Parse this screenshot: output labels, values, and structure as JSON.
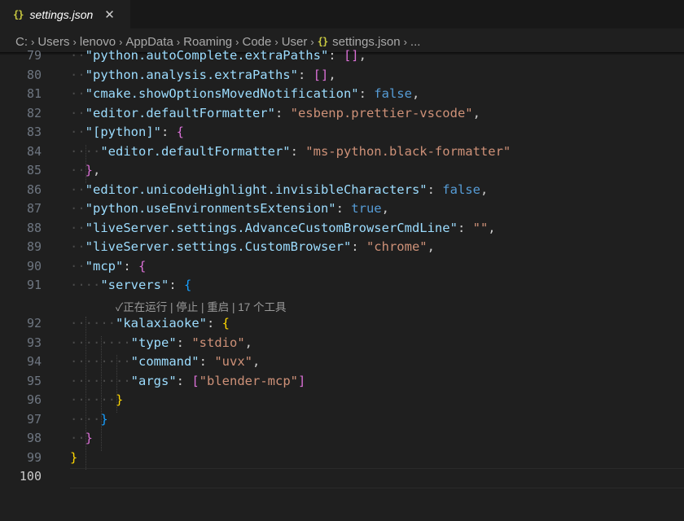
{
  "tab": {
    "icon": "{}",
    "title": "settings.json",
    "close": "✕"
  },
  "breadcrumb": [
    "C:",
    "Users",
    "lenovo",
    "AppData",
    "Roaming",
    "Code",
    "User"
  ],
  "breadcrumb_file": "settings.json",
  "breadcrumb_more": "...",
  "codelens": "✓正在运行 | 停止 | 重启 | 17 个工具",
  "lines": [
    {
      "n": "79",
      "tokens": [
        [
          "ws",
          "··"
        ],
        [
          "key",
          "\"python.autoComplete.extraPaths\""
        ],
        [
          "p",
          ": "
        ],
        [
          "b1",
          "[]"
        ],
        [
          "p",
          ","
        ]
      ]
    },
    {
      "n": "80",
      "tokens": [
        [
          "ws",
          "··"
        ],
        [
          "key",
          "\"python.analysis.extraPaths\""
        ],
        [
          "p",
          ": "
        ],
        [
          "b1",
          "[]"
        ],
        [
          "p",
          ","
        ]
      ]
    },
    {
      "n": "81",
      "tokens": [
        [
          "ws",
          "··"
        ],
        [
          "key",
          "\"cmake.showOptionsMovedNotification\""
        ],
        [
          "p",
          ": "
        ],
        [
          "kw",
          "false"
        ],
        [
          "p",
          ","
        ]
      ]
    },
    {
      "n": "82",
      "tokens": [
        [
          "ws",
          "··"
        ],
        [
          "key",
          "\"editor.defaultFormatter\""
        ],
        [
          "p",
          ": "
        ],
        [
          "str",
          "\"esbenp.prettier-vscode\""
        ],
        [
          "p",
          ","
        ]
      ]
    },
    {
      "n": "83",
      "tokens": [
        [
          "ws",
          "··"
        ],
        [
          "key",
          "\"[python]\""
        ],
        [
          "p",
          ": "
        ],
        [
          "b1",
          "{"
        ]
      ]
    },
    {
      "n": "84",
      "tokens": [
        [
          "ws",
          "····"
        ],
        [
          "key",
          "\"editor.defaultFormatter\""
        ],
        [
          "p",
          ": "
        ],
        [
          "str",
          "\"ms-python.black-formatter\""
        ]
      ]
    },
    {
      "n": "85",
      "tokens": [
        [
          "ws",
          "··"
        ],
        [
          "b1",
          "}"
        ],
        [
          "p",
          ","
        ]
      ]
    },
    {
      "n": "86",
      "tokens": [
        [
          "ws",
          "··"
        ],
        [
          "key",
          "\"editor.unicodeHighlight.invisibleCharacters\""
        ],
        [
          "p",
          ": "
        ],
        [
          "kw",
          "false"
        ],
        [
          "p",
          ","
        ]
      ]
    },
    {
      "n": "87",
      "tokens": [
        [
          "ws",
          "··"
        ],
        [
          "key",
          "\"python.useEnvironmentsExtension\""
        ],
        [
          "p",
          ": "
        ],
        [
          "kw",
          "true"
        ],
        [
          "p",
          ","
        ]
      ]
    },
    {
      "n": "88",
      "tokens": [
        [
          "ws",
          "··"
        ],
        [
          "key",
          "\"liveServer.settings.AdvanceCustomBrowserCmdLine\""
        ],
        [
          "p",
          ": "
        ],
        [
          "str",
          "\"\""
        ],
        [
          "p",
          ","
        ]
      ]
    },
    {
      "n": "89",
      "tokens": [
        [
          "ws",
          "··"
        ],
        [
          "key",
          "\"liveServer.settings.CustomBrowser\""
        ],
        [
          "p",
          ": "
        ],
        [
          "str",
          "\"chrome\""
        ],
        [
          "p",
          ","
        ]
      ]
    },
    {
      "n": "90",
      "tokens": [
        [
          "ws",
          "··"
        ],
        [
          "key",
          "\"mcp\""
        ],
        [
          "p",
          ": "
        ],
        [
          "b1",
          "{"
        ]
      ]
    },
    {
      "n": "91",
      "tokens": [
        [
          "ws",
          "····"
        ],
        [
          "key",
          "\"servers\""
        ],
        [
          "p",
          ": "
        ],
        [
          "b2",
          "{"
        ]
      ]
    },
    {
      "n": "92",
      "tokens": [
        [
          "ws",
          "······"
        ],
        [
          "key",
          "\"kalaxiaoke\""
        ],
        [
          "p",
          ": "
        ],
        [
          "b3",
          "{"
        ]
      ]
    },
    {
      "n": "93",
      "tokens": [
        [
          "ws",
          "········"
        ],
        [
          "key",
          "\"type\""
        ],
        [
          "p",
          ": "
        ],
        [
          "str",
          "\"stdio\""
        ],
        [
          "p",
          ","
        ]
      ]
    },
    {
      "n": "94",
      "tokens": [
        [
          "ws",
          "········"
        ],
        [
          "key",
          "\"command\""
        ],
        [
          "p",
          ": "
        ],
        [
          "str",
          "\"uvx\""
        ],
        [
          "p",
          ","
        ]
      ]
    },
    {
      "n": "95",
      "tokens": [
        [
          "ws",
          "········"
        ],
        [
          "key",
          "\"args\""
        ],
        [
          "p",
          ": "
        ],
        [
          "b1",
          "["
        ],
        [
          "str",
          "\"blender-mcp\""
        ],
        [
          "b1",
          "]"
        ]
      ]
    },
    {
      "n": "96",
      "tokens": [
        [
          "ws",
          "······"
        ],
        [
          "b3",
          "}"
        ]
      ]
    },
    {
      "n": "97",
      "tokens": [
        [
          "ws",
          "····"
        ],
        [
          "b2",
          "}"
        ]
      ]
    },
    {
      "n": "98",
      "tokens": [
        [
          "ws",
          "··"
        ],
        [
          "b1",
          "}"
        ]
      ]
    },
    {
      "n": "99",
      "tokens": [
        [
          "b3",
          "}"
        ]
      ]
    },
    {
      "n": "100",
      "tokens": []
    }
  ]
}
